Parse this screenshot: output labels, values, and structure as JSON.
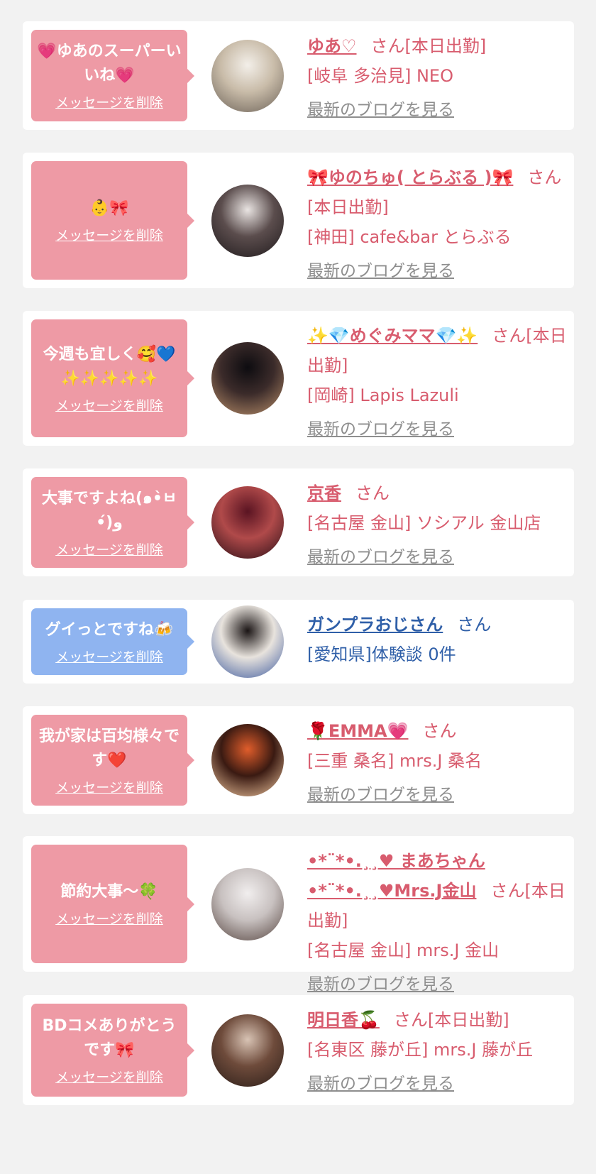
{
  "items": [
    {
      "message": "💗ゆあのスーパーいいね💗",
      "delete_label": "メッセージを削除",
      "name": "ゆあ♡",
      "suffix": "さん[本日出勤]",
      "shop": "[岐阜 多治見] NEO",
      "blog_label": "最新のブログを見る",
      "theme": "pink",
      "avatar_colors": [
        "#f3efe9",
        "#c9bca9",
        "#6b6157"
      ]
    },
    {
      "message": "👶🎀",
      "delete_label": "メッセージを削除",
      "name": "🎀ゆのちゅ( とらぶる )🎀",
      "suffix": "さん[本日出勤]",
      "shop": "[神田] cafe&bar とらぶる",
      "blog_label": "最新のブログを見る",
      "theme": "pink",
      "avatar_colors": [
        "#e9e4e2",
        "#5b4d4d",
        "#1f1a1c"
      ]
    },
    {
      "message": "今週も宜しく🥰💙✨✨✨✨✨",
      "delete_label": "メッセージを削除",
      "name": "✨💎めぐみママ💎✨",
      "suffix": "さん[本日出勤]",
      "shop": "[岡崎] Lapis Lazuli",
      "blog_label": "最新のブログを見る",
      "theme": "pink",
      "avatar_colors": [
        "#0d0c10",
        "#3b2b2a",
        "#b98f6a"
      ]
    },
    {
      "message": "大事ですよね(๑•̀ㅂ•́)و",
      "delete_label": "メッセージを削除",
      "name": "京香",
      "suffix": "さん",
      "shop": "[名古屋 金山] ソシアル 金山店",
      "blog_label": "最新のブログを見る",
      "theme": "pink",
      "avatar_colors": [
        "#5a1422",
        "#b04a4a",
        "#2a0e16"
      ]
    },
    {
      "message": "グイっとですね🍻",
      "delete_label": "メッセージを削除",
      "name": "ガンプラおじさん",
      "suffix": "さん",
      "shop": "[愛知県]体験談 0件",
      "blog_label": "",
      "theme": "blue",
      "avatar_colors": [
        "#1b1515",
        "#e8e3dd",
        "#3d5a9e"
      ]
    },
    {
      "message": "我が家は百均様々です❤️",
      "delete_label": "メッセージを削除",
      "name": "🌹EMMA💗",
      "suffix": "さん",
      "shop": "[三重 桑名] mrs.J 桑名",
      "blog_label": "最新のブログを見る",
      "theme": "pink",
      "avatar_colors": [
        "#e05d2b",
        "#3a1a12",
        "#f2c8a0"
      ]
    },
    {
      "message": "節約大事〜🍀",
      "delete_label": "メッセージを削除",
      "name": "•*¨*•.¸¸♥ まあちゃん•*¨*•.¸¸♥Mrs.J金山",
      "suffix": "さん[本日出勤]",
      "shop": "[名古屋 金山] mrs.J 金山",
      "blog_label": "最新のブログを見る",
      "theme": "pink",
      "avatar_colors": [
        "#f1eeee",
        "#c8c1c0",
        "#55443f"
      ]
    },
    {
      "message": "BDコメありがとうです🎀",
      "delete_label": "メッセージを削除",
      "name": "明日香🍒",
      "suffix": "さん[本日出勤]",
      "shop": "[名東区 藤が丘] mrs.J 藤が丘",
      "blog_label": "最新のブログを見る",
      "theme": "pink",
      "avatar_colors": [
        "#d8c3b4",
        "#6e4b3b",
        "#2a1d18"
      ]
    }
  ]
}
